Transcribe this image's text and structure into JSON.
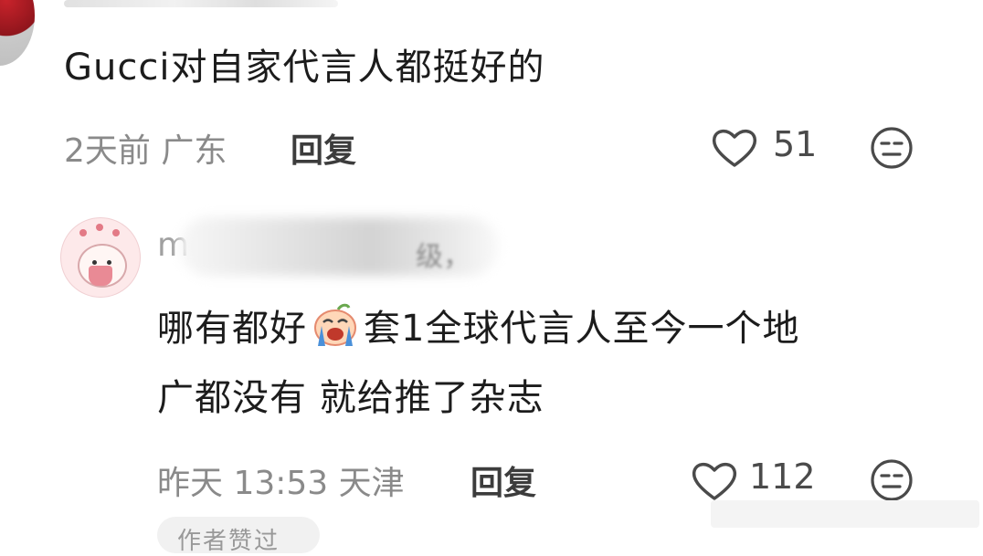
{
  "comments": [
    {
      "text": "Gucci对自家代言人都挺好的",
      "meta": "2天前 广东",
      "reply_label": "回复",
      "likes": "51",
      "like_icon": "heart-icon",
      "dislike_icon": "meh-face-icon"
    },
    {
      "username_visible": "mo",
      "username_tail": "级，",
      "text_line1_a": "哪有都好",
      "text_line1_b": "套1全球代言人至今一个地",
      "text_line2": "广都没有 就给推了杂志",
      "emoji": "crying-face-emoji",
      "meta": "昨天 13:53 天津",
      "reply_label": "回复",
      "likes": "112",
      "like_icon": "heart-icon",
      "dislike_icon": "meh-face-icon"
    }
  ],
  "footer_chip": "作者赞过"
}
